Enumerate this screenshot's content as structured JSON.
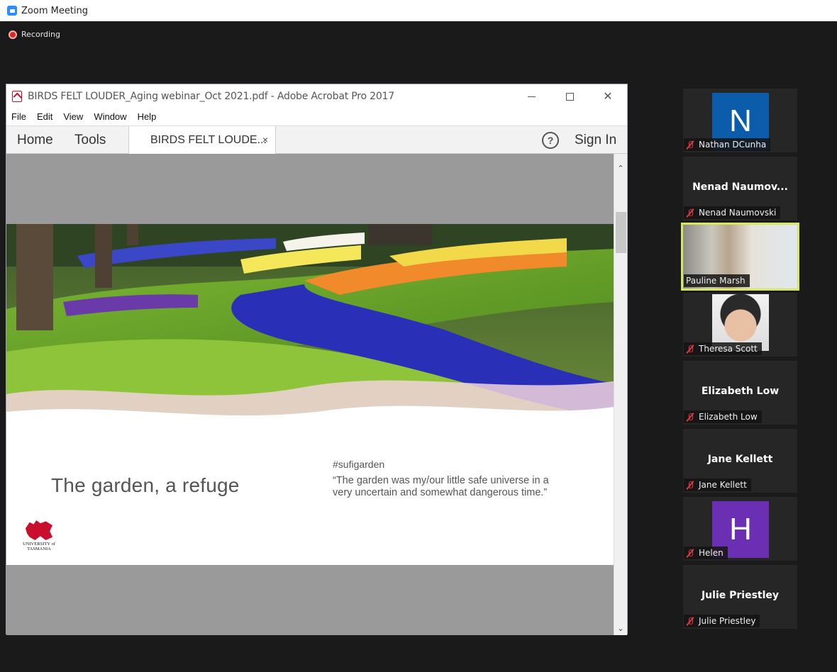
{
  "zoom": {
    "title": "Zoom Meeting",
    "recording_label": "Recording"
  },
  "acrobat": {
    "title": "BIRDS FELT LOUDER_Aging webinar_Oct 2021.pdf - Adobe Acrobat Pro 2017",
    "window_controls": {
      "minimize": "—",
      "close": "✕"
    },
    "menu": [
      "File",
      "Edit",
      "View",
      "Window",
      "Help"
    ],
    "tabs": {
      "home": "Home",
      "tools": "Tools",
      "document": "BIRDS FELT LOUDE...",
      "close": "×"
    },
    "help": "?",
    "sign_in": "Sign In",
    "scroll": {
      "up": "⌃",
      "down": "⌄"
    }
  },
  "slide": {
    "title": "The garden, a refuge",
    "hashtag": "#sufigarden",
    "quote": "“The garden was my/our little safe universe in a very uncertain and somewhat dangerous time.”",
    "logo_text_line1": "UNIVERSITY of",
    "logo_text_line2": "TASMANIA"
  },
  "participants": [
    {
      "type": "letter",
      "letter": "N",
      "color": "#0b5cab",
      "name": "Nathan DCunha",
      "muted": true
    },
    {
      "type": "bigname",
      "display": "Nenad  Naumov...",
      "name": "Nenad Naumovski",
      "muted": true
    },
    {
      "type": "video",
      "name": "Pauline Marsh",
      "muted": false,
      "active": true
    },
    {
      "type": "photo",
      "name": "Theresa Scott",
      "muted": true
    },
    {
      "type": "bigname",
      "display": "Elizabeth Low",
      "name": "Elizabeth Low",
      "muted": true
    },
    {
      "type": "bigname",
      "display": "Jane Kellett",
      "name": "Jane Kellett",
      "muted": true
    },
    {
      "type": "letter",
      "letter": "H",
      "color": "#6a2fb3",
      "name": "Helen",
      "muted": true
    },
    {
      "type": "bigname",
      "display": "Julie Priestley",
      "name": "Julie Priestley",
      "muted": true
    }
  ],
  "colors": {
    "zoom_accent": "#2d8cff",
    "recording": "#e02424",
    "active_speaker": "#d6e764",
    "muted_icon": "#e03b3b"
  }
}
